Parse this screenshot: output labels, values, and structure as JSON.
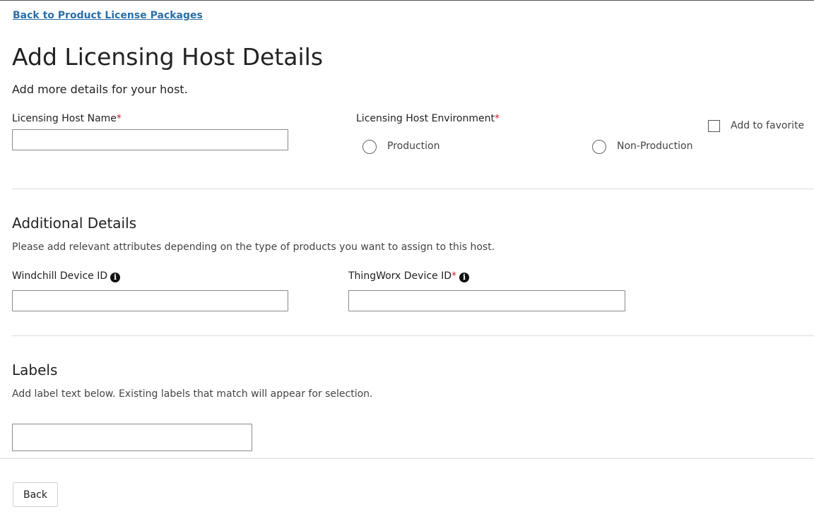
{
  "nav": {
    "back_link": "Back to Product License Packages"
  },
  "header": {
    "title": "Add Licensing Host Details",
    "subtitle": "Add more details for your host."
  },
  "host": {
    "name_label": "Licensing Host Name",
    "name_value": "",
    "required_marker": "*",
    "environment_label": "Licensing Host Environment",
    "environment_options": [
      "Production",
      "Non-Production"
    ],
    "favorite_label": "Add to favorite"
  },
  "additional": {
    "title": "Additional Details",
    "description": "Please add relevant attributes depending on the type of products you want to assign to this host.",
    "windchill_label": "Windchill Device ID",
    "thingworx_label": "ThingWorx Device ID",
    "info_icon": "i"
  },
  "labels": {
    "title": "Labels",
    "description": "Add label text below. Existing labels that match will appear for selection.",
    "input_value": ""
  },
  "footer": {
    "back_button": "Back"
  },
  "colors": {
    "link": "#2a6fa8",
    "required": "#d0202a"
  },
  "icons": {
    "info": "info-circle-icon",
    "radio": "radio-unchecked-icon",
    "checkbox": "checkbox-unchecked-icon"
  }
}
